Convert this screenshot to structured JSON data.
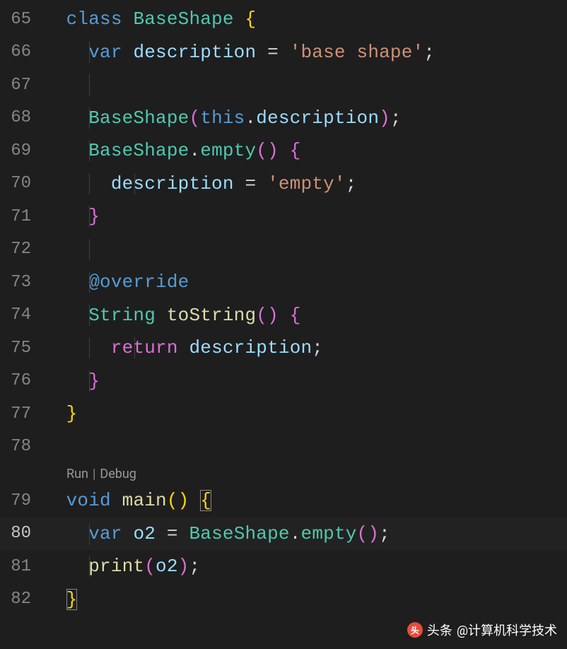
{
  "gutter": {
    "l65": "65",
    "l66": "66",
    "l67": "67",
    "l68": "68",
    "l69": "69",
    "l70": "70",
    "l71": "71",
    "l72": "72",
    "l73": "73",
    "l74": "74",
    "l75": "75",
    "l76": "76",
    "l77": "77",
    "l78": "78",
    "l79": "79",
    "l80": "80",
    "l81": "81",
    "l82": "82"
  },
  "code": {
    "kw_class": "class",
    "type_BaseShape": "BaseShape",
    "brace_open": "{",
    "brace_close": "}",
    "kw_var": "var",
    "id_description": "description",
    "op_eq": " = ",
    "str_base_shape": "'base shape'",
    "semi": ";",
    "ctor_BaseShape": "BaseShape",
    "paren_open": "(",
    "paren_close": ")",
    "kw_this": "this",
    "dot": ".",
    "ctor_empty": "empty",
    "str_empty": "'empty'",
    "anno_override": "@override",
    "type_String": "String",
    "fn_toString": "toString",
    "kw_return": "return",
    "kw_void": "void",
    "fn_main": "main",
    "id_o2": "o2",
    "fn_print": "print"
  },
  "codelens": {
    "run": "Run",
    "sep": "|",
    "debug": "Debug"
  },
  "watermark": {
    "prefix": "头条",
    "handle": "@计算机科学技术"
  }
}
